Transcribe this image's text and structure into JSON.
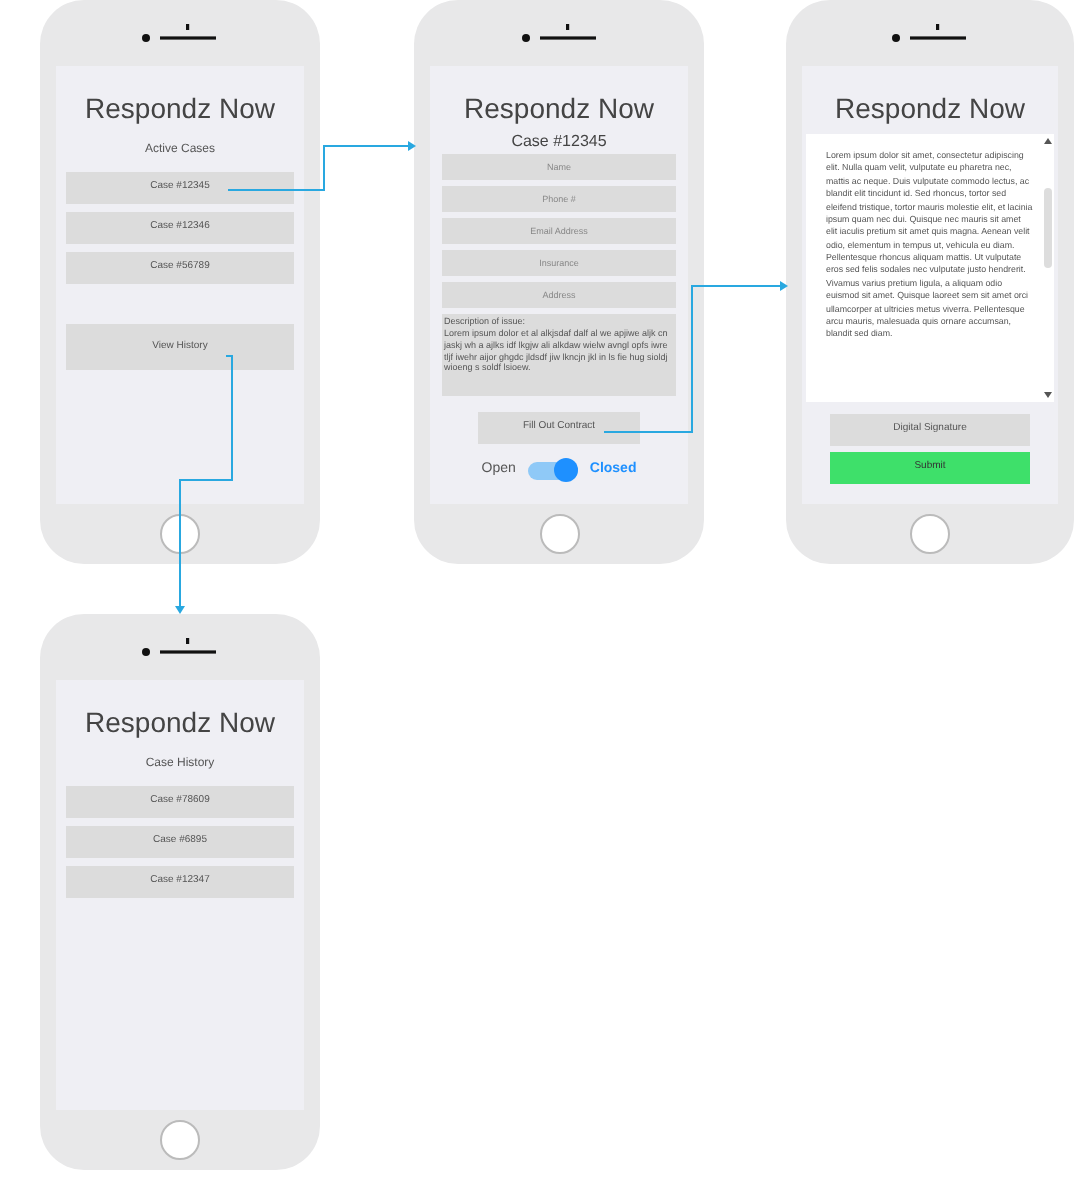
{
  "screens": [
    {
      "kind": "list",
      "title": "Respondz Now",
      "subtitle": "Active Cases",
      "items": [
        "Case #12345",
        "Case #12346",
        "Case #56789"
      ],
      "action": "View History"
    },
    {
      "kind": "form",
      "title": "Respondz Now",
      "subtitle": "Case #12345",
      "fields": [
        {
          "placeholder": "Name"
        },
        {
          "placeholder": "Phone #"
        },
        {
          "placeholder": "Email Address"
        },
        {
          "placeholder": "Insurance"
        },
        {
          "placeholder": "Address"
        }
      ],
      "description": {
        "label": "Description of issue:",
        "text": "Lorem ipsum dolor et al alkjsdaf dalf al we apjiwe aljk cn jaskj wh a ajlks idf lkgjw ali alkdaw wielw avngl opfs iwre tljf iwehr aijor ghgdc jldsdf jiw lkncjn jkl in ls fie hug sioldj wioeng s soldf lsioew."
      },
      "action": "Fill Out Contract",
      "toggle": {
        "off_label": "Open",
        "on_label": "Closed",
        "on": true
      }
    },
    {
      "kind": "contract",
      "title": "Respondz Now",
      "body": "Lorem ipsum dolor sit amet, consectetur adipiscing elit. Nulla quam velit, vulputate eu pharetra nec, mattis ac neque. Duis vulputate commodo lectus, ac blandit elit tincidunt id. Sed rhoncus, tortor sed eleifend tristique, tortor mauris molestie elit, et lacinia ipsum quam nec dui. Quisque nec mauris sit amet elit iaculis pretium sit amet quis magna. Aenean velit odio, elementum in tempus ut, vehicula eu diam. Pellentesque rhoncus aliquam mattis. Ut vulputate eros sed felis sodales nec vulputate justo hendrerit. Vivamus varius pretium ligula, a aliquam odio euismod sit amet. Quisque laoreet sem sit amet orci ullamcorper at ultricies metus viverra. Pellentesque arcu mauris, malesuada quis ornare accumsan, blandit sed diam.",
      "buttons": [
        {
          "label": "Digital Signature",
          "kind": "secondary"
        },
        {
          "label": "Submit",
          "kind": "primary"
        }
      ]
    },
    {
      "kind": "list",
      "title": "Respondz Now",
      "subtitle": "Case History",
      "items": [
        "Case #78609",
        "Case #6895",
        "Case #12347"
      ]
    }
  ]
}
